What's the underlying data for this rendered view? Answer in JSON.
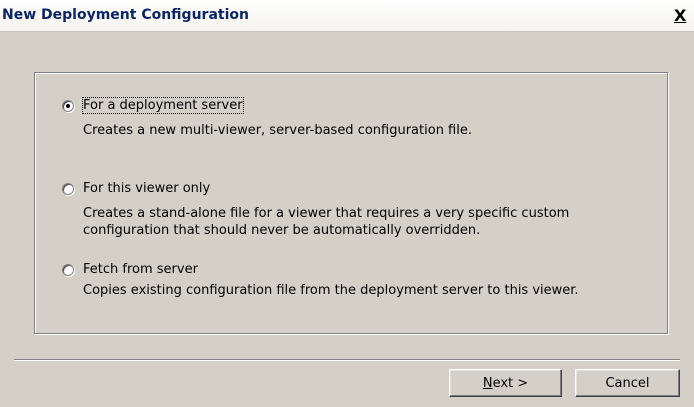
{
  "window": {
    "title": "New Deployment Configuration",
    "close_glyph": "X"
  },
  "options": [
    {
      "label": "For a deployment server",
      "description_lines": [
        "Creates a new multi-viewer, server-based configuration file."
      ],
      "selected": true
    },
    {
      "label": "For this viewer only",
      "description_lines": [
        "Creates a stand-alone file for a viewer that requires a very specific custom",
        "configuration that should never be automatically overridden."
      ],
      "selected": false
    },
    {
      "label": "Fetch from server",
      "description_lines": [
        "Copies existing configuration file from the deployment server to this viewer."
      ],
      "selected": false
    }
  ],
  "buttons": {
    "next_accel": "N",
    "next_rest": "ext >",
    "cancel": "Cancel"
  }
}
